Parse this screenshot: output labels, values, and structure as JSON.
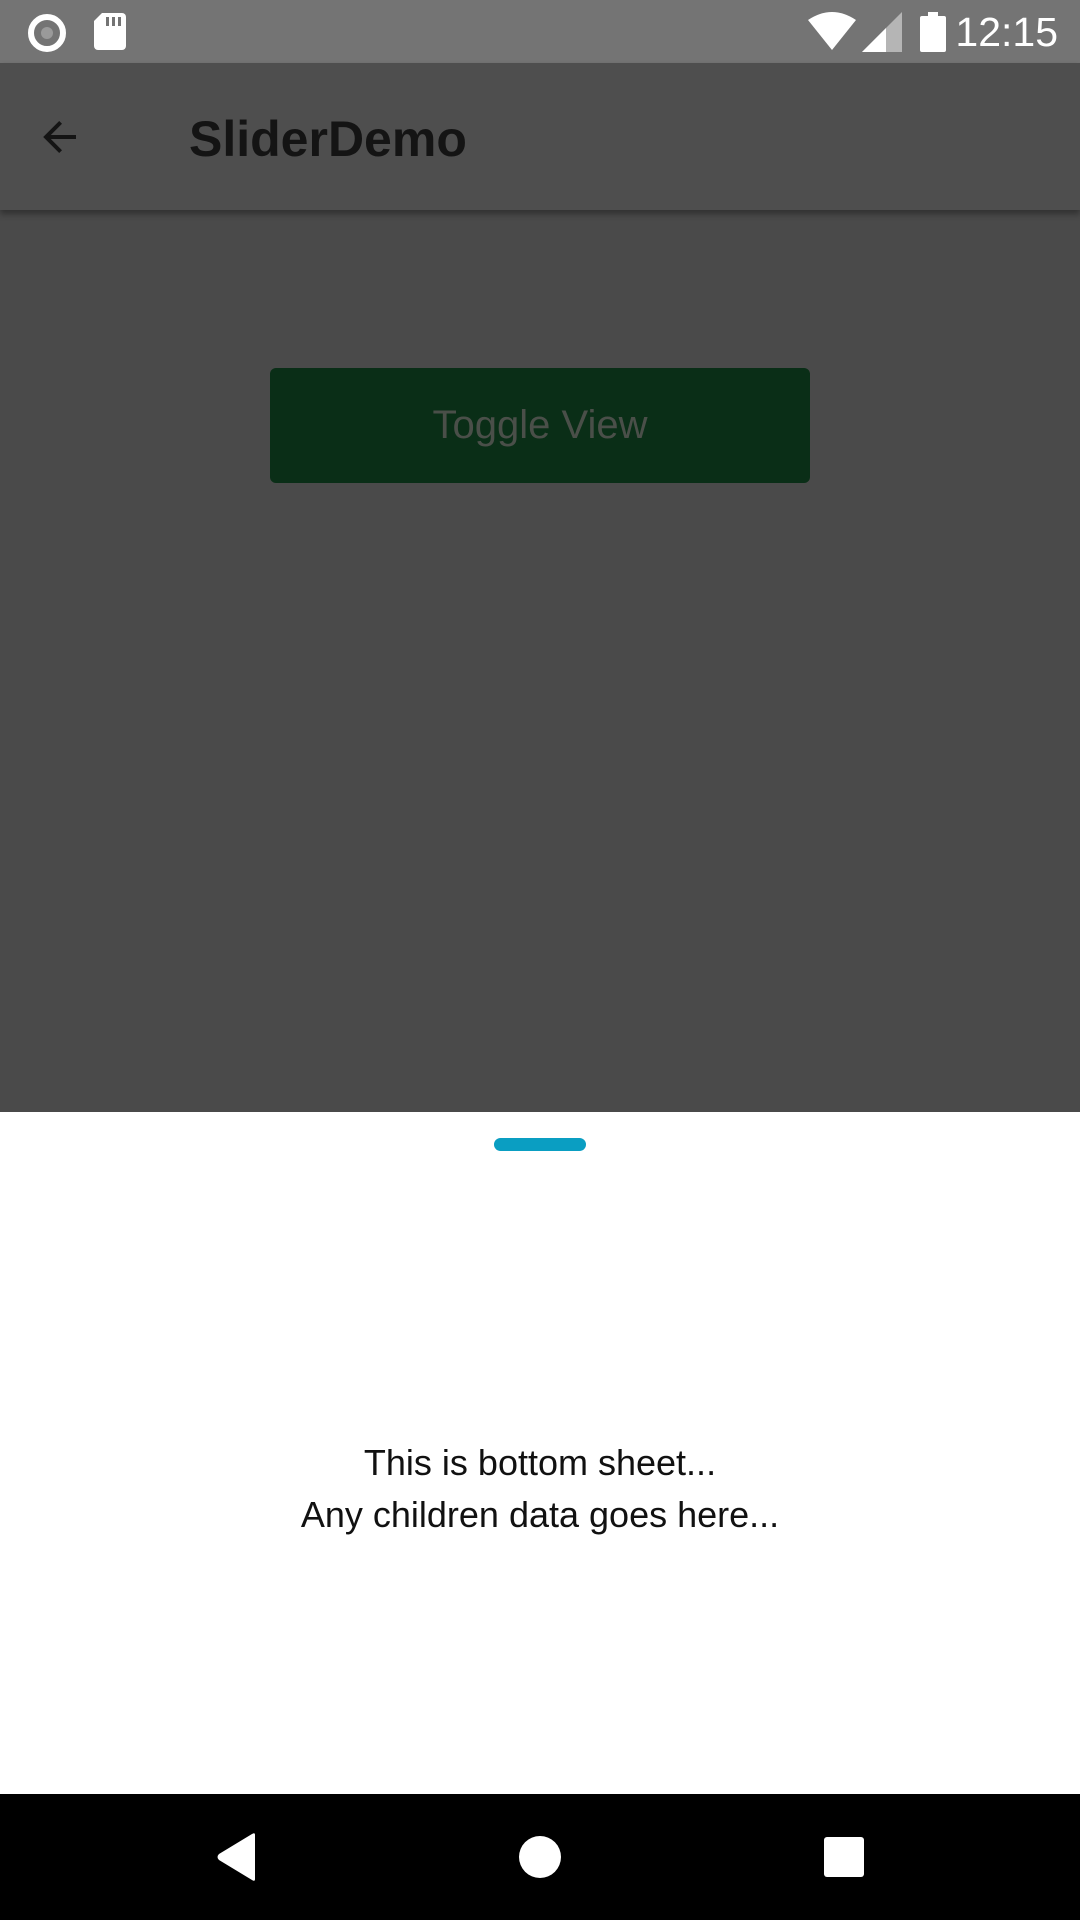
{
  "status_bar": {
    "time": "12:15",
    "icons": [
      "record-icon",
      "sd-card-icon",
      "wifi-icon",
      "signal-icon",
      "battery-icon"
    ]
  },
  "app_bar": {
    "title": "SliderDemo",
    "back_icon": "arrow-back-icon"
  },
  "content": {
    "toggle_button_label": "Toggle View"
  },
  "bottom_sheet": {
    "line1": "This is bottom sheet...",
    "line2": "Any children data goes here..."
  },
  "nav_bar": {
    "icons": [
      "nav-back-icon",
      "nav-home-icon",
      "nav-recents-icon"
    ]
  },
  "colors": {
    "status_bar": "#747474",
    "app_bar": "#4e4e4e",
    "scrim": "#4a4a4a",
    "toggle_button": "#0a2e17",
    "drag_handle": "#0a9ec2",
    "nav_bar": "#000000"
  }
}
